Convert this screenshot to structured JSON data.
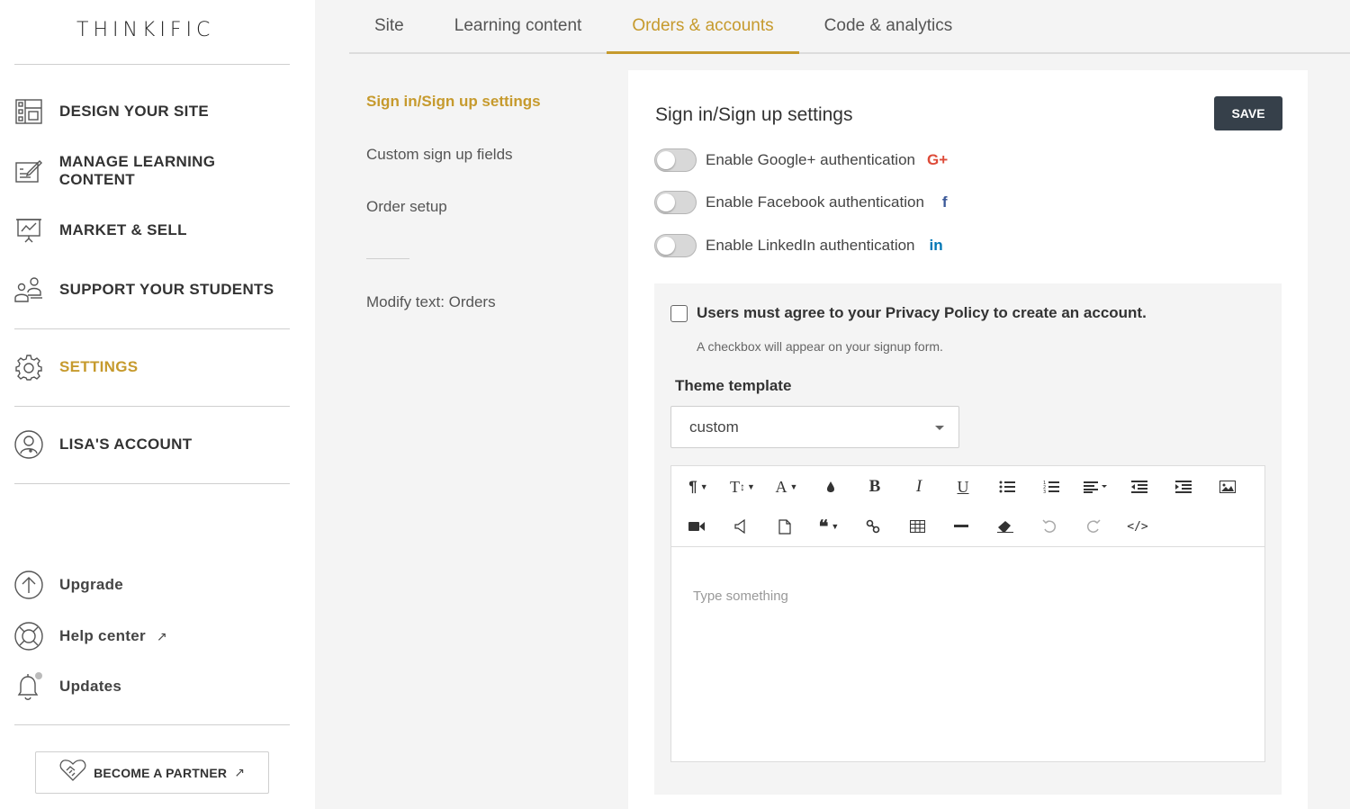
{
  "brand": {
    "logo": "THINKIFIC"
  },
  "sidebar": {
    "items": [
      {
        "label": "DESIGN YOUR SITE",
        "icon": "layout-icon"
      },
      {
        "label": "MANAGE LEARNING CONTENT",
        "icon": "edit-content-icon"
      },
      {
        "label": "MARKET & SELL",
        "icon": "presentation-chart-icon"
      },
      {
        "label": "SUPPORT YOUR STUDENTS",
        "icon": "people-icon"
      },
      {
        "label": "SETTINGS",
        "icon": "gear-icon",
        "active": true
      },
      {
        "label": "LISA'S ACCOUNT",
        "icon": "user-circle-icon"
      }
    ],
    "utilities": [
      {
        "label": "Upgrade",
        "icon": "upgrade-arrow-icon"
      },
      {
        "label": "Help center",
        "icon": "lifebuoy-icon",
        "external": true
      },
      {
        "label": "Updates",
        "icon": "bell-icon"
      }
    ],
    "partner_button": "BECOME A PARTNER"
  },
  "tabs": [
    {
      "label": "Site"
    },
    {
      "label": "Learning content"
    },
    {
      "label": "Orders & accounts",
      "active": true
    },
    {
      "label": "Code & analytics"
    }
  ],
  "subnav": {
    "items": [
      {
        "label": "Sign in/Sign up settings",
        "active": true
      },
      {
        "label": "Custom sign up fields"
      },
      {
        "label": "Order setup"
      },
      {
        "label": "Modify text: Orders"
      }
    ]
  },
  "main": {
    "title": "Sign in/Sign up settings",
    "save_label": "SAVE",
    "toggles": [
      {
        "label": "Enable Google+ authentication",
        "icon_text": "G+",
        "color": "#dd4b39",
        "on": false
      },
      {
        "label": "Enable Facebook authentication",
        "icon_text": "f",
        "color": "#3b5998",
        "on": false
      },
      {
        "label": "Enable LinkedIn authentication",
        "icon_text": "in",
        "color": "#0077b5",
        "on": false
      }
    ],
    "privacy": {
      "label": "Users must agree to your Privacy Policy to create an account.",
      "help": "A checkbox will appear on your signup form.",
      "checked": false
    },
    "theme": {
      "label": "Theme template",
      "selected": "custom"
    },
    "editor": {
      "placeholder": "Type something"
    }
  },
  "colors": {
    "accent": "#c69a2d",
    "save_bg": "#36404a"
  }
}
